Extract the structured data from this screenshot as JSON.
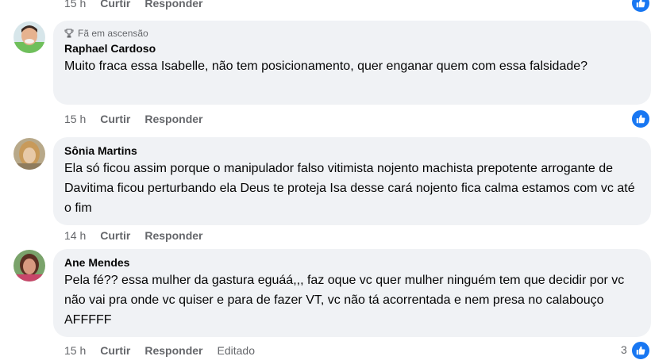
{
  "top_actions": {
    "time": "15 h",
    "like": "Curtir",
    "reply": "Responder"
  },
  "comments": [
    {
      "badge": "Fã em ascensão",
      "author": "Raphael Cardoso",
      "text": "Muito fraca essa Isabelle, não tem posicionamento, quer enganar quem com essa falsidade?",
      "time": "15 h",
      "like": "Curtir",
      "reply": "Responder"
    },
    {
      "author": "Sônia Martins",
      "text": "Ela só ficou assim porque o manipulador falso vitimista nojento machista prepotente arrogante de Davitima ficou perturbando ela Deus te proteja Isa desse cará nojento fica calma estamos com vc até o fim",
      "time": "14 h",
      "like": "Curtir",
      "reply": "Responder"
    },
    {
      "author": "Ane Mendes",
      "text": "Pela fé?? essa mulher da gastura eguáá,,, faz oque vc quer mulher ninguém tem que decidir por vc não vai pra onde vc quiser e para de fazer VT, vc não tá acorrentada e nem presa no calabouço AFFFFF",
      "time": "15 h",
      "like": "Curtir",
      "reply": "Responder",
      "edited": "Editado",
      "reaction_count": "3"
    }
  ],
  "colors": {
    "bubble": "#f0f2f5",
    "meta": "#65676b",
    "like_blue": "#1877f2"
  },
  "icons": [
    "thumbs-up-icon",
    "trophy-icon"
  ]
}
